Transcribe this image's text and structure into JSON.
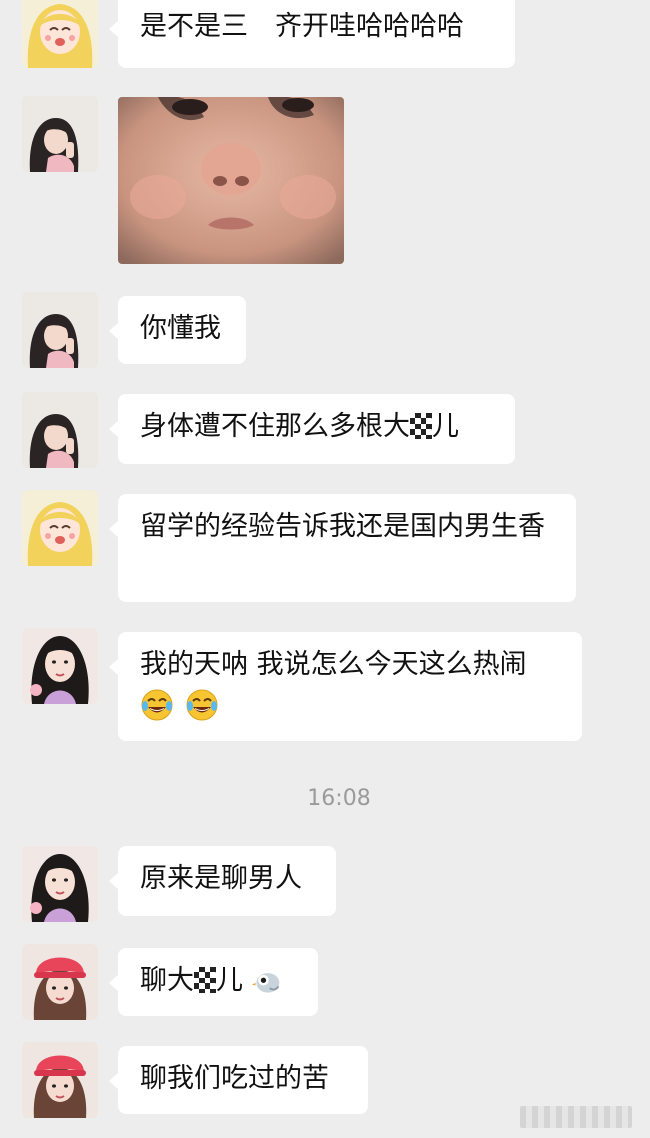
{
  "chat": {
    "background": "#ededed",
    "bubble_color": "#ffffff",
    "messages": [
      {
        "avatar": "blonde-cartoon-girl-avatar",
        "text": "是不是三　齐开哇哈哈哈哈"
      },
      {
        "avatar": "dark-hair-girl-avatar",
        "image": "baby-face-sticker"
      },
      {
        "avatar": "dark-hair-girl-avatar",
        "text": "你懂我"
      },
      {
        "avatar": "dark-hair-girl-avatar",
        "text_before": "身体遭不住那么多根大",
        "text_after": "儿"
      },
      {
        "avatar": "blonde-cartoon-girl-avatar",
        "text": "留学的经验告诉我还是国内男生香"
      },
      {
        "avatar": "long-hair-girl-avatar",
        "text": "我的天呐 我说怎么今天这么热闹",
        "emoji": "laughing-crying-emoji"
      },
      {
        "avatar": "long-hair-girl-avatar",
        "text": "原来是聊男人"
      },
      {
        "avatar": "pink-hat-girl-avatar",
        "text_before": "聊大",
        "text_after": "儿",
        "emoji": "bird-emoji"
      },
      {
        "avatar": "pink-hat-girl-avatar",
        "text": "聊我们吃过的苦"
      }
    ],
    "timestamp": "16:08"
  }
}
